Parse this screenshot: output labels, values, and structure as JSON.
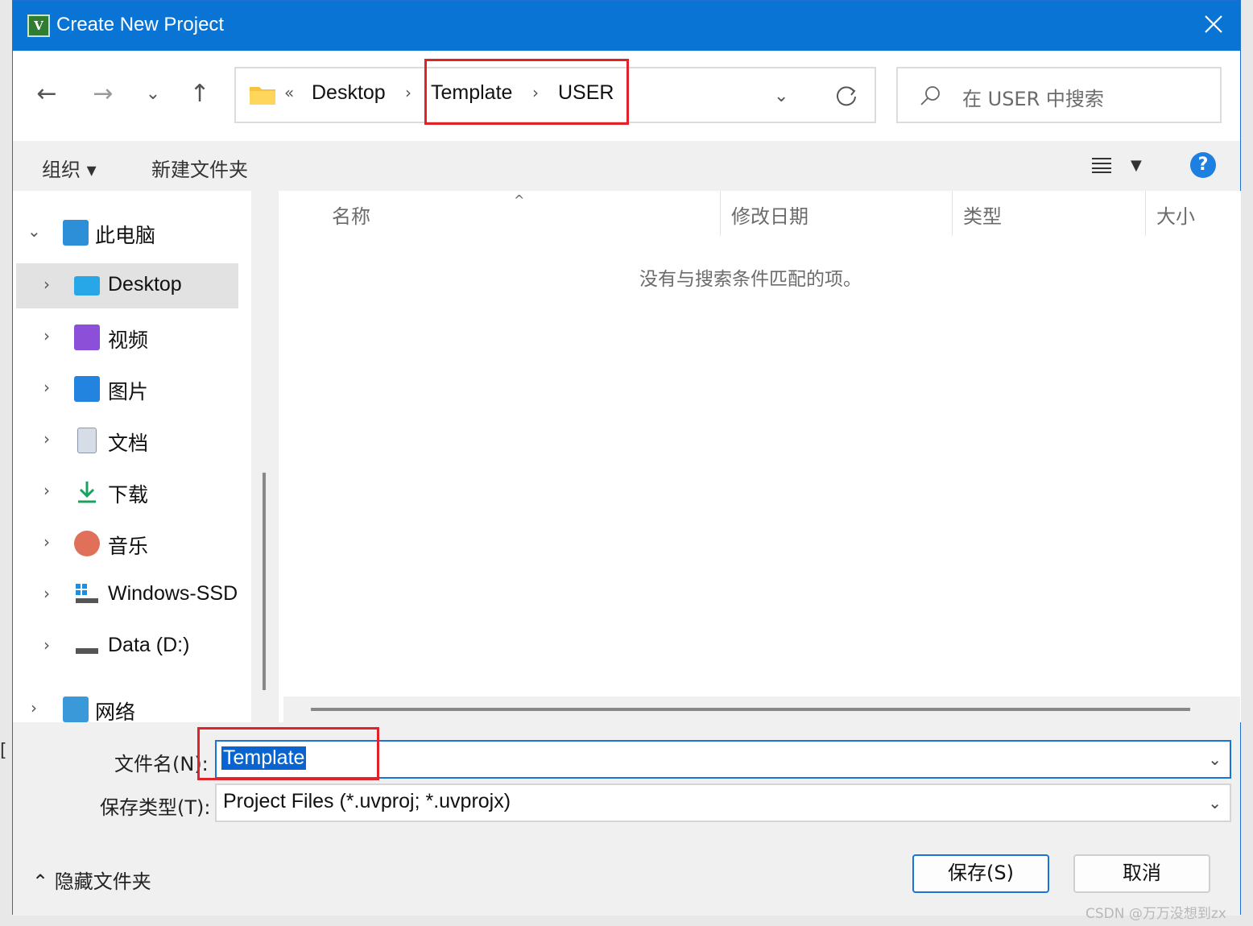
{
  "window": {
    "title": "Create New Project",
    "app_icon_text": "V"
  },
  "nav": {
    "back": "←",
    "forward": "→",
    "recent": "⌄",
    "up": "↑",
    "breadcrumb_overflow": "«",
    "breadcrumbs": [
      "Desktop",
      "Template",
      "USER"
    ],
    "search_placeholder": "在 USER 中搜索"
  },
  "toolbar": {
    "organize": "组织 ▾",
    "new_folder": "新建文件夹",
    "help": "?"
  },
  "sidebar": {
    "items": [
      {
        "label": "此电脑",
        "icon": "computer-icon"
      },
      {
        "label": "Desktop",
        "icon": "desktop-icon"
      },
      {
        "label": "视频",
        "icon": "video-icon"
      },
      {
        "label": "图片",
        "icon": "pictures-icon"
      },
      {
        "label": "文档",
        "icon": "documents-icon"
      },
      {
        "label": "下载",
        "icon": "download-icon"
      },
      {
        "label": "音乐",
        "icon": "music-icon"
      },
      {
        "label": "Windows-SSD",
        "icon": "drive-windows-icon"
      },
      {
        "label": "Data (D:)",
        "icon": "drive-icon"
      },
      {
        "label": "网络",
        "icon": "network-icon"
      }
    ]
  },
  "file_list": {
    "columns": [
      "名称",
      "修改日期",
      "类型",
      "大小"
    ],
    "sort_indicator": "^",
    "empty_message": "没有与搜索条件匹配的项。"
  },
  "form": {
    "filename_label": "文件名(N):",
    "filename_value": "Template",
    "filetype_label": "保存类型(T):",
    "filetype_value": "Project Files (*.uvproj; *.uvprojx)"
  },
  "footer": {
    "hide_folders": "隐藏文件夹",
    "save": "保存(S)",
    "cancel": "取消"
  },
  "watermark": "CSDN @万万没想到zx",
  "colors": {
    "titlebar": "#0a74d4",
    "highlight": "#e0232b",
    "selection": "#0a64d0"
  }
}
